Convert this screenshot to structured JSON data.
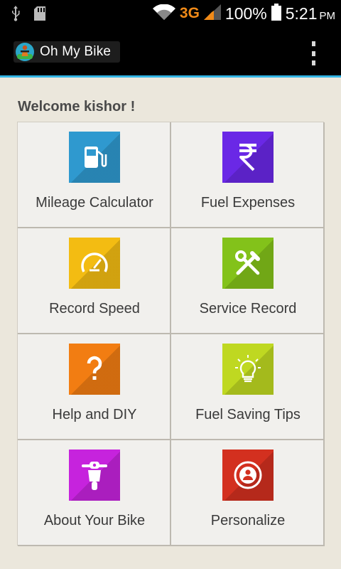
{
  "status_bar": {
    "icons": [
      "usb-icon",
      "sd-card-icon",
      "wifi-icon",
      "signal-icon",
      "battery-icon"
    ],
    "network": "3G",
    "battery": "100%",
    "time": "5:21",
    "ampm": "PM"
  },
  "app_bar": {
    "title": "Oh My Bike",
    "logo_icon": "biker-logo-icon",
    "menu_icon": "overflow-menu-icon"
  },
  "welcome": "Welcome kishor !",
  "tiles": [
    {
      "label": "Mileage Calculator",
      "icon": "fuel-pump-icon",
      "color": "#2f99cf"
    },
    {
      "label": "Fuel Expenses",
      "icon": "rupee-icon",
      "color": "#6a28e6"
    },
    {
      "label": "Record Speed",
      "icon": "speedometer-icon",
      "color": "#f3bc12"
    },
    {
      "label": "Service Record",
      "icon": "tools-icon",
      "color": "#83c21a"
    },
    {
      "label": "Help and DIY",
      "icon": "question-icon",
      "color": "#f27d12"
    },
    {
      "label": "Fuel Saving Tips",
      "icon": "lightbulb-icon",
      "color": "#bfd821"
    },
    {
      "label": "About Your Bike",
      "icon": "motorbike-icon",
      "color": "#c623dd"
    },
    {
      "label": "Personalize",
      "icon": "user-icon",
      "color": "#d3301f"
    }
  ],
  "colors": {
    "action_bar_accent": "#33b5e5",
    "network_text": "#f08a18"
  }
}
